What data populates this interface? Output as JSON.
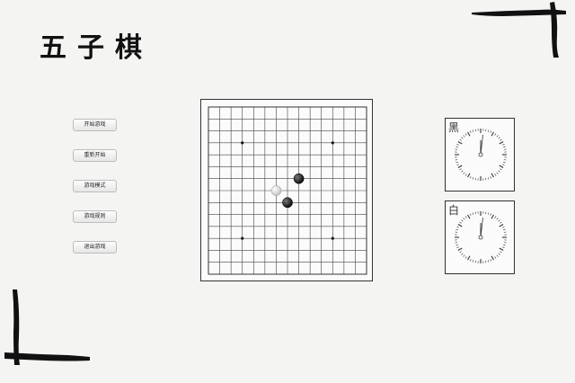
{
  "app": {
    "title": "五子棋"
  },
  "menu": {
    "start": "开始游戏",
    "restart": "重新开始",
    "mode": "游戏模式",
    "rules": "游戏规则",
    "exit": "退出游戏"
  },
  "board": {
    "grid_lines": 15,
    "star_points": [
      [
        3,
        3
      ],
      [
        3,
        11
      ],
      [
        11,
        3
      ],
      [
        11,
        11
      ]
    ],
    "stones": [
      {
        "color": "black",
        "col": 8,
        "row": 6
      },
      {
        "color": "white",
        "col": 6,
        "row": 7
      },
      {
        "color": "black",
        "col": 7,
        "row": 8
      }
    ]
  },
  "clocks": {
    "black": {
      "label": "黑"
    },
    "white": {
      "label": "白"
    }
  },
  "colors": {
    "background": "#f4f4f2",
    "ink": "#111111",
    "line": "#333333"
  }
}
